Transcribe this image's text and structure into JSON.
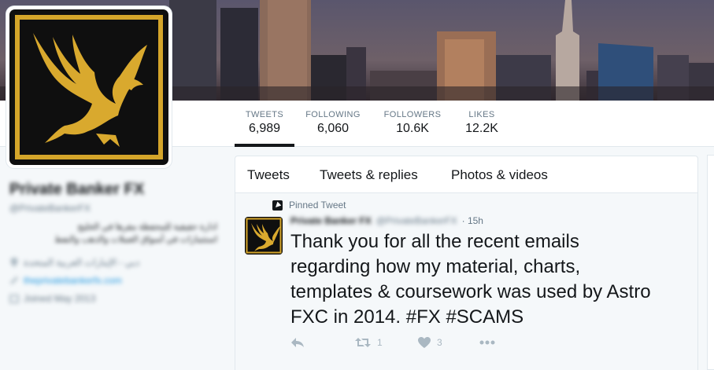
{
  "colors": {
    "text": "#14171a",
    "muted": "#657786",
    "link": "#1b95e0",
    "gold": "#d4a52a",
    "border": "#e1e8ed"
  },
  "nav": {
    "tweets": {
      "label": "TWEETS",
      "value": "6,989"
    },
    "following": {
      "label": "FOLLOWING",
      "value": "6,060"
    },
    "followers": {
      "label": "FOLLOWERS",
      "value": "10.6K"
    },
    "likes": {
      "label": "LIKES",
      "value": "12.2K"
    }
  },
  "profile": {
    "name": "Private Banker FX",
    "handle": "@PrivateBankerFX",
    "bio_line1": "ادارة حقيقية للمحفظة مقرها في الخليج",
    "bio_line2": "استثمارات في أسواق العملات والذهب والنفط",
    "location": "دبي - الإمارات العربية المتحدة",
    "website": "theprivatebankerfx.com",
    "joined": "Joined May 2013"
  },
  "tabs": [
    "Tweets",
    "Tweets & replies",
    "Photos & videos"
  ],
  "tweet": {
    "pinned_label": "Pinned Tweet",
    "author_name": "Private Banker FX",
    "author_handle": "@PrivateBankerFX",
    "time": "· 15h",
    "text_main": "Thank you for all the recent emails regarding how my material, charts, templates  & coursework was used by Astro FXC in 2014. ",
    "hashtag1": "#FX",
    "hashtag2": "#SCAMS",
    "retweet_count": "1",
    "like_count": "3"
  },
  "icons": [
    "eagle-logo-icon",
    "pin-icon",
    "reply-icon",
    "retweet-icon",
    "heart-icon",
    "more-icon",
    "location-icon",
    "link-icon",
    "calendar-icon"
  ]
}
